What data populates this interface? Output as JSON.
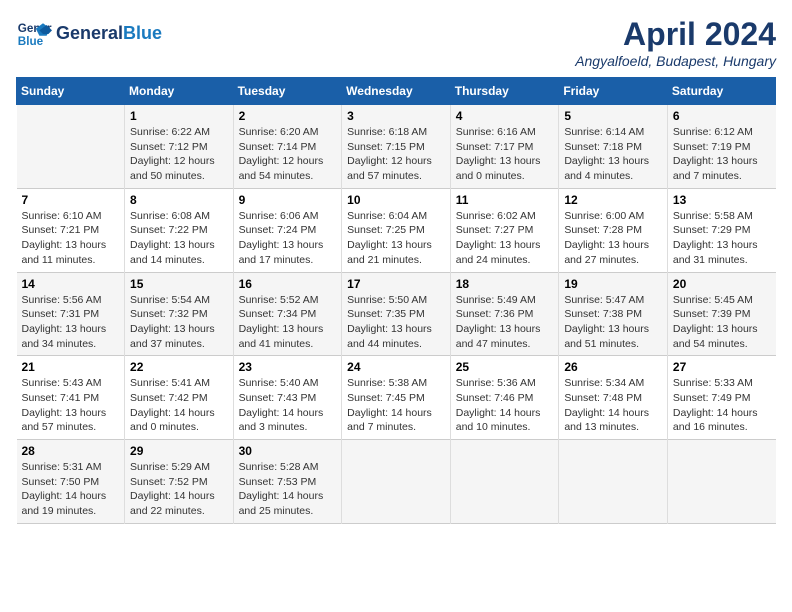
{
  "header": {
    "logo_line1": "General",
    "logo_line2": "Blue",
    "title": "April 2024",
    "subtitle": "Angyalfoeld, Budapest, Hungary"
  },
  "days_of_week": [
    "Sunday",
    "Monday",
    "Tuesday",
    "Wednesday",
    "Thursday",
    "Friday",
    "Saturday"
  ],
  "weeks": [
    [
      {
        "day": "",
        "info": ""
      },
      {
        "day": "1",
        "info": "Sunrise: 6:22 AM\nSunset: 7:12 PM\nDaylight: 12 hours\nand 50 minutes."
      },
      {
        "day": "2",
        "info": "Sunrise: 6:20 AM\nSunset: 7:14 PM\nDaylight: 12 hours\nand 54 minutes."
      },
      {
        "day": "3",
        "info": "Sunrise: 6:18 AM\nSunset: 7:15 PM\nDaylight: 12 hours\nand 57 minutes."
      },
      {
        "day": "4",
        "info": "Sunrise: 6:16 AM\nSunset: 7:17 PM\nDaylight: 13 hours\nand 0 minutes."
      },
      {
        "day": "5",
        "info": "Sunrise: 6:14 AM\nSunset: 7:18 PM\nDaylight: 13 hours\nand 4 minutes."
      },
      {
        "day": "6",
        "info": "Sunrise: 6:12 AM\nSunset: 7:19 PM\nDaylight: 13 hours\nand 7 minutes."
      }
    ],
    [
      {
        "day": "7",
        "info": "Sunrise: 6:10 AM\nSunset: 7:21 PM\nDaylight: 13 hours\nand 11 minutes."
      },
      {
        "day": "8",
        "info": "Sunrise: 6:08 AM\nSunset: 7:22 PM\nDaylight: 13 hours\nand 14 minutes."
      },
      {
        "day": "9",
        "info": "Sunrise: 6:06 AM\nSunset: 7:24 PM\nDaylight: 13 hours\nand 17 minutes."
      },
      {
        "day": "10",
        "info": "Sunrise: 6:04 AM\nSunset: 7:25 PM\nDaylight: 13 hours\nand 21 minutes."
      },
      {
        "day": "11",
        "info": "Sunrise: 6:02 AM\nSunset: 7:27 PM\nDaylight: 13 hours\nand 24 minutes."
      },
      {
        "day": "12",
        "info": "Sunrise: 6:00 AM\nSunset: 7:28 PM\nDaylight: 13 hours\nand 27 minutes."
      },
      {
        "day": "13",
        "info": "Sunrise: 5:58 AM\nSunset: 7:29 PM\nDaylight: 13 hours\nand 31 minutes."
      }
    ],
    [
      {
        "day": "14",
        "info": "Sunrise: 5:56 AM\nSunset: 7:31 PM\nDaylight: 13 hours\nand 34 minutes."
      },
      {
        "day": "15",
        "info": "Sunrise: 5:54 AM\nSunset: 7:32 PM\nDaylight: 13 hours\nand 37 minutes."
      },
      {
        "day": "16",
        "info": "Sunrise: 5:52 AM\nSunset: 7:34 PM\nDaylight: 13 hours\nand 41 minutes."
      },
      {
        "day": "17",
        "info": "Sunrise: 5:50 AM\nSunset: 7:35 PM\nDaylight: 13 hours\nand 44 minutes."
      },
      {
        "day": "18",
        "info": "Sunrise: 5:49 AM\nSunset: 7:36 PM\nDaylight: 13 hours\nand 47 minutes."
      },
      {
        "day": "19",
        "info": "Sunrise: 5:47 AM\nSunset: 7:38 PM\nDaylight: 13 hours\nand 51 minutes."
      },
      {
        "day": "20",
        "info": "Sunrise: 5:45 AM\nSunset: 7:39 PM\nDaylight: 13 hours\nand 54 minutes."
      }
    ],
    [
      {
        "day": "21",
        "info": "Sunrise: 5:43 AM\nSunset: 7:41 PM\nDaylight: 13 hours\nand 57 minutes."
      },
      {
        "day": "22",
        "info": "Sunrise: 5:41 AM\nSunset: 7:42 PM\nDaylight: 14 hours\nand 0 minutes."
      },
      {
        "day": "23",
        "info": "Sunrise: 5:40 AM\nSunset: 7:43 PM\nDaylight: 14 hours\nand 3 minutes."
      },
      {
        "day": "24",
        "info": "Sunrise: 5:38 AM\nSunset: 7:45 PM\nDaylight: 14 hours\nand 7 minutes."
      },
      {
        "day": "25",
        "info": "Sunrise: 5:36 AM\nSunset: 7:46 PM\nDaylight: 14 hours\nand 10 minutes."
      },
      {
        "day": "26",
        "info": "Sunrise: 5:34 AM\nSunset: 7:48 PM\nDaylight: 14 hours\nand 13 minutes."
      },
      {
        "day": "27",
        "info": "Sunrise: 5:33 AM\nSunset: 7:49 PM\nDaylight: 14 hours\nand 16 minutes."
      }
    ],
    [
      {
        "day": "28",
        "info": "Sunrise: 5:31 AM\nSunset: 7:50 PM\nDaylight: 14 hours\nand 19 minutes."
      },
      {
        "day": "29",
        "info": "Sunrise: 5:29 AM\nSunset: 7:52 PM\nDaylight: 14 hours\nand 22 minutes."
      },
      {
        "day": "30",
        "info": "Sunrise: 5:28 AM\nSunset: 7:53 PM\nDaylight: 14 hours\nand 25 minutes."
      },
      {
        "day": "",
        "info": ""
      },
      {
        "day": "",
        "info": ""
      },
      {
        "day": "",
        "info": ""
      },
      {
        "day": "",
        "info": ""
      }
    ]
  ]
}
